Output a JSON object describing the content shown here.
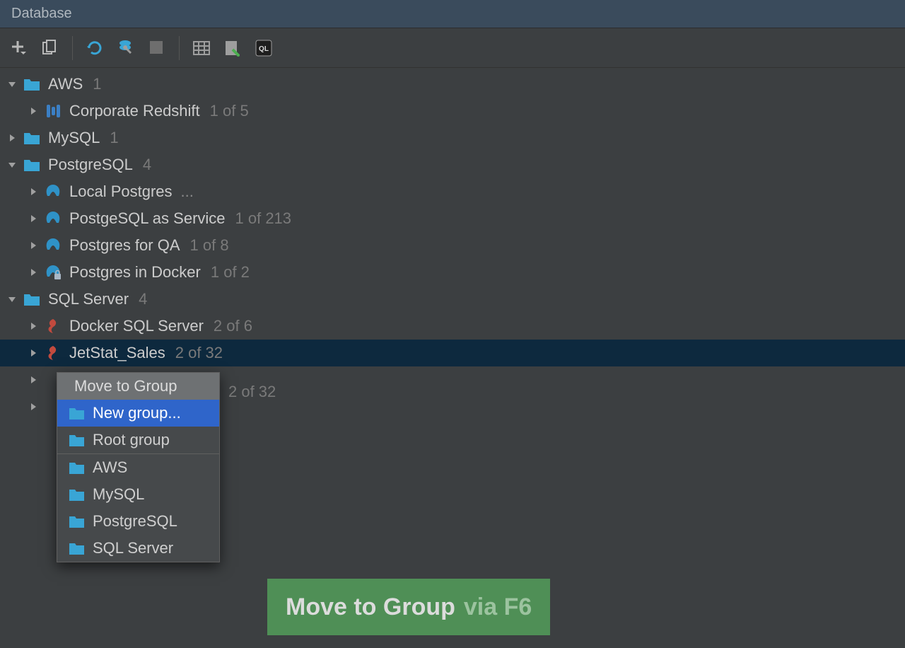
{
  "title": "Database",
  "tree": {
    "aws": {
      "label": "AWS",
      "count": "1",
      "children": {
        "redshift": {
          "label": "Corporate Redshift",
          "count": "1 of 5"
        }
      }
    },
    "mysql": {
      "label": "MySQL",
      "count": "1"
    },
    "pg": {
      "label": "PostgreSQL",
      "count": "4",
      "children": {
        "local": {
          "label": "Local Postgres",
          "ell": "..."
        },
        "paas": {
          "label": "PostgeSQL as Service",
          "count": "1 of 213"
        },
        "qa": {
          "label": "Postgres for QA",
          "count": "1 of 8"
        },
        "docker": {
          "label": "Postgres in Docker",
          "count": "1 of 2"
        }
      }
    },
    "mssql": {
      "label": "SQL Server",
      "count": "4",
      "children": {
        "docker": {
          "label": "Docker SQL Server",
          "count": "2 of 6"
        },
        "jetstat": {
          "label": "JetStat_Sales",
          "count": "2 of 32"
        },
        "hidden_count": "2 of 32"
      }
    }
  },
  "menu": {
    "title": "Move to Group",
    "items": {
      "new": "New group...",
      "root": "Root group",
      "aws": "AWS",
      "mysql": "MySQL",
      "pg": "PostgreSQL",
      "mssql": "SQL Server"
    }
  },
  "badge": {
    "main": "Move to Group",
    "tail": "via F6"
  }
}
